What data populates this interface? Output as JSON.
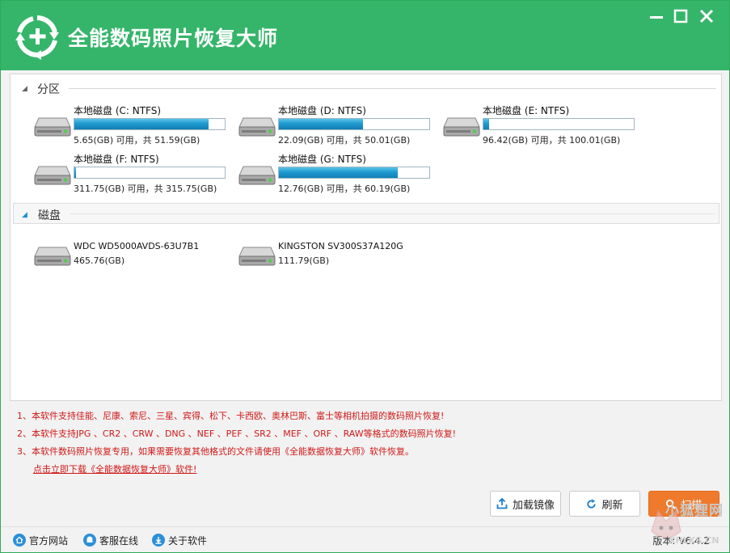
{
  "app": {
    "title": "全能数码照片恢复大师"
  },
  "sections": {
    "partition_label": "分区",
    "disk_label": "磁盘"
  },
  "partitions": [
    {
      "name": "本地磁盘 (C: NTFS)",
      "info": "5.65(GB) 可用，共 51.59(GB)",
      "used_fraction": 0.89
    },
    {
      "name": "本地磁盘 (D: NTFS)",
      "info": "22.09(GB) 可用，共 50.01(GB)",
      "used_fraction": 0.56
    },
    {
      "name": "本地磁盘 (E: NTFS)",
      "info": "96.42(GB) 可用，共 100.01(GB)",
      "used_fraction": 0.04
    },
    {
      "name": "本地磁盘 (F: NTFS)",
      "info": "311.75(GB) 可用，共 315.75(GB)",
      "used_fraction": 0.01
    },
    {
      "name": "本地磁盘 (G: NTFS)",
      "info": "12.76(GB) 可用，共 60.19(GB)",
      "used_fraction": 0.79
    }
  ],
  "disks": [
    {
      "name": "WDC WD5000AVDS-63U7B1",
      "size": "465.76(GB)"
    },
    {
      "name": "KINGSTON SV300S37A120G",
      "size": "111.79(GB)"
    }
  ],
  "notes": [
    "1、本软件支持佳能、尼康、索尼、三星、宾得、松下、卡西欧、奥林巴斯、富士等相机拍摄的数码照片恢复!",
    "2、本软件支持JPG 、CR2 、CRW 、DNG 、NEF 、PEF 、SR2 、MEF 、ORF 、RAW等格式的数码照片恢复!",
    "3、本软件数码照片恢复专用，如果需要恢复其他格式的文件请使用《全能数据恢复大师》软件恢复。"
  ],
  "download_link": "点击立即下载《全能数据恢复大师》软件!",
  "buttons": {
    "mount": "加载镜像",
    "refresh": "刷新",
    "scan": "扫描"
  },
  "status": {
    "website": "官方网站",
    "support": "客服在线",
    "about": "关于软件",
    "version": "版本: V6.4.2"
  },
  "watermark": {
    "text": "小狐狸网",
    "sub": "XHLKS.CN"
  },
  "colors": {
    "titlebar": "#35b56a",
    "scan_button": "#ef7a2c",
    "note_text": "#d01818",
    "progress": "#1f9ad0"
  }
}
